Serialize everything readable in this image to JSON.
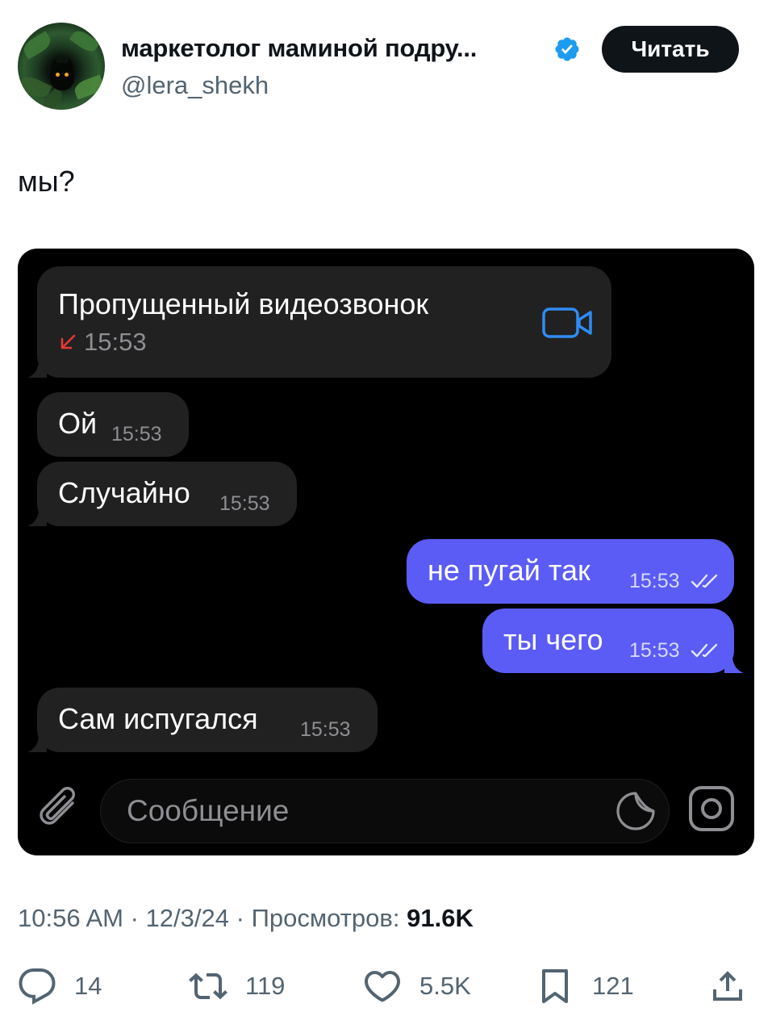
{
  "author": {
    "display_name": "маркетолог маминой подру...",
    "handle": "@lera_shekh",
    "follow_label": "Читать"
  },
  "tweet": {
    "text": "мы?"
  },
  "chat": {
    "missed_call": {
      "title": "Пропущенный видеозвонок",
      "time": "15:53"
    },
    "messages": [
      {
        "direction": "in",
        "text": "Ой",
        "time": "15:53"
      },
      {
        "direction": "in",
        "text": "Случайно",
        "time": "15:53"
      },
      {
        "direction": "out",
        "text": "не пугай так",
        "time": "15:53"
      },
      {
        "direction": "out",
        "text": "ты чего",
        "time": "15:53"
      },
      {
        "direction": "in",
        "text": "Сам испугался",
        "time": "15:53"
      }
    ],
    "input_placeholder": "Сообщение",
    "colors": {
      "background": "#000000",
      "incoming": "#212121",
      "outgoing": "#5b5cf6",
      "accent": "#2f8cf6",
      "missed": "#e53935"
    }
  },
  "meta": {
    "time": "10:56 AM",
    "date": "12/3/24",
    "views_label": "Просмотров:",
    "views_count": "91.6K",
    "sep": "·"
  },
  "actions": {
    "replies": "14",
    "retweets": "119",
    "likes": "5.5K",
    "bookmarks": "121"
  },
  "icons": [
    "verified-badge-icon",
    "video-camera-icon",
    "missed-call-arrow-icon",
    "paperclip-icon",
    "sticker-icon",
    "camera-icon",
    "reply-icon",
    "retweet-icon",
    "like-icon",
    "bookmark-icon",
    "share-icon"
  ]
}
